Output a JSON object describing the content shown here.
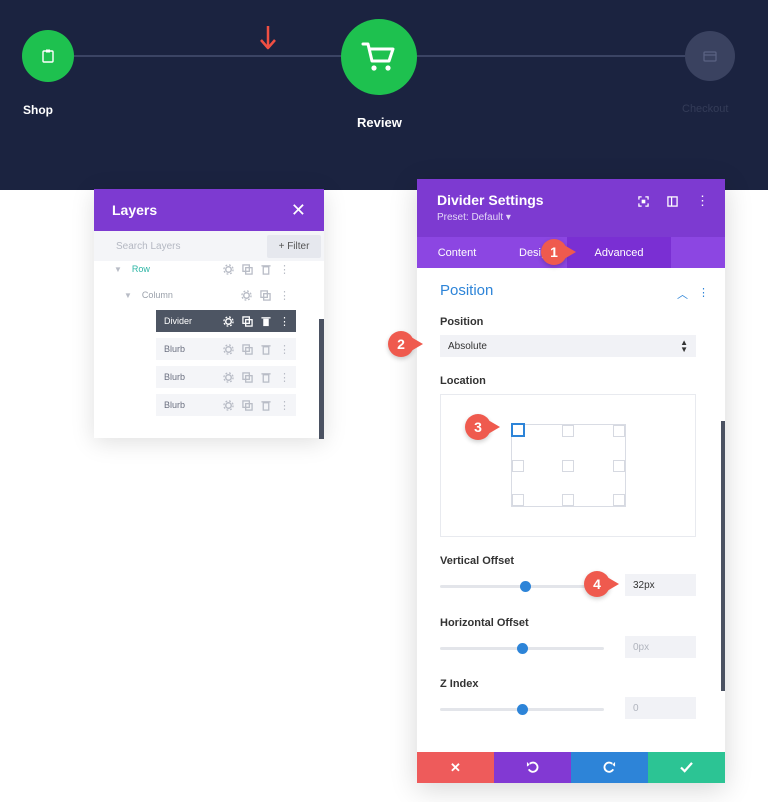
{
  "banner": {
    "steps": [
      {
        "label": "Shop",
        "icon": "clipboard-icon"
      },
      {
        "label": "Review",
        "icon": "cart-icon"
      },
      {
        "label": "Checkout",
        "icon": "card-icon"
      }
    ],
    "colors": {
      "bg": "#1b2340",
      "active": "#1ec14f",
      "inactive": "#3a4260",
      "arrow": "#ef4f43"
    }
  },
  "layers": {
    "title": "Layers",
    "search_placeholder": "Search Layers",
    "filter_label": "+ Filter",
    "tree": {
      "row": "Row",
      "column": "Column",
      "modules": [
        "Divider",
        "Blurb",
        "Blurb",
        "Blurb"
      ],
      "active_index": 0
    }
  },
  "settings": {
    "title": "Divider Settings",
    "preset": "Preset: Default ▾",
    "tabs": {
      "content": "Content",
      "design": "Design",
      "advanced": "Advanced"
    },
    "section_title": "Position",
    "position": {
      "label": "Position",
      "value": "Absolute"
    },
    "location": {
      "label": "Location",
      "selected": "top-left"
    },
    "vertical_offset": {
      "label": "Vertical Offset",
      "value": "32px",
      "slider_fraction": 0.52
    },
    "horizontal_offset": {
      "label": "Horizontal Offset",
      "value": "0px",
      "slider_fraction": 0.5
    },
    "z_index": {
      "label": "Z Index",
      "value": "0",
      "slider_fraction": 0.5
    },
    "footer_icons": [
      "close-icon",
      "undo-icon",
      "redo-icon",
      "check-icon"
    ],
    "colors": {
      "header": "#7d3ad1",
      "tabs": "#8c46e2",
      "accent": "#2d84d8"
    }
  },
  "callouts": [
    "1",
    "2",
    "3",
    "4"
  ]
}
